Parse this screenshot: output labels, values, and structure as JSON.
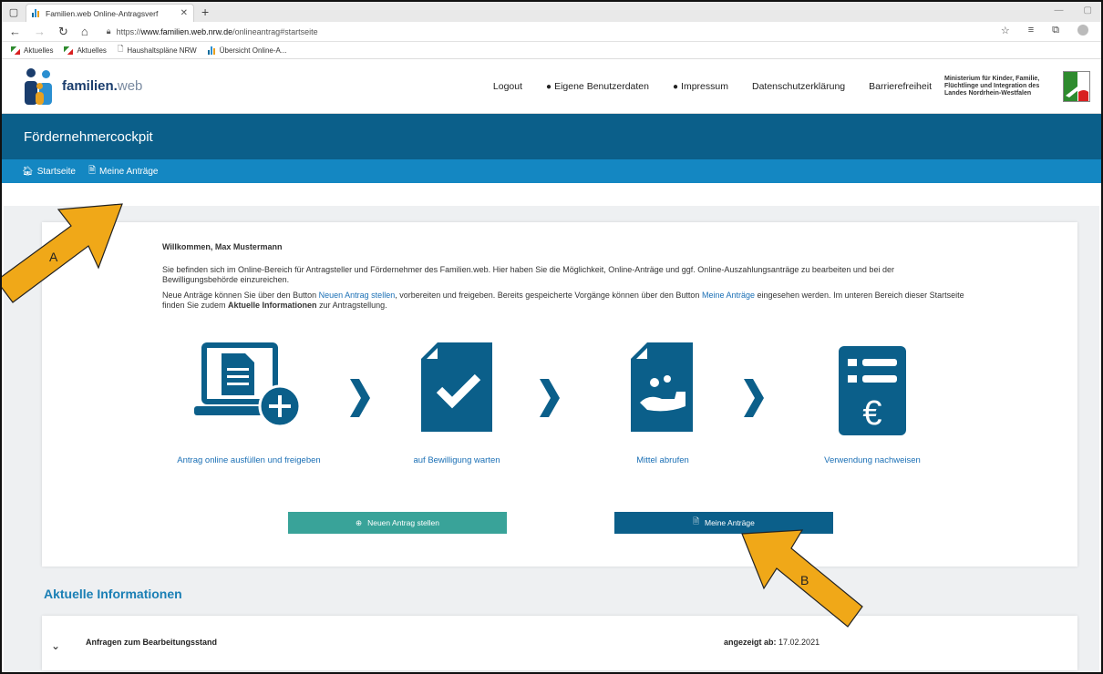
{
  "browser": {
    "tab_title": "Familien.web Online-Antragsverf",
    "url_prefix": "https://",
    "url_host": "www.familien.web.nrw.de",
    "url_path": "/onlineantrag#startseite",
    "bookmarks": [
      "Aktuelles",
      "Aktuelles",
      "Haushaltspläne NRW",
      "Übersicht Online-A..."
    ]
  },
  "header": {
    "logo_bold": "familien.",
    "logo_light": "web",
    "nav": [
      "Logout",
      "Eigene Benutzerdaten",
      "Impressum",
      "Datenschutzerklärung",
      "Barrierefreiheit"
    ],
    "ministry": "Ministerium für Kinder, Familie, Flüchtlinge und Integration des Landes Nordrhein-Westfalen"
  },
  "banner": {
    "title": "Fördernehmercockpit"
  },
  "subnav": {
    "home": "Startseite",
    "my_applications": "Meine Anträge"
  },
  "welcome": {
    "greeting": "Willkommen, Max Mustermann",
    "p1": "Sie befinden sich im Online-Bereich für Antragsteller und Fördernehmer des Familien.web. Hier haben Sie die Möglichkeit, Online-Anträge und ggf. Online-Auszahlungsanträge zu bearbeiten und bei der Bewilligungsbehörde einzureichen.",
    "p2_a": "Neue Anträge können Sie über den Button ",
    "p2_link1": "Neuen Antrag stellen",
    "p2_b": ", vorbereiten und freigeben. Bereits gespeicherte Vorgänge können über den Button ",
    "p2_link2": "Meine Anträge",
    "p2_c": " eingesehen werden. Im unteren Bereich dieser Startseite finden Sie zudem ",
    "p2_bold": "Aktuelle Informationen",
    "p2_d": " zur Antragstellung."
  },
  "steps": [
    {
      "label": "Antrag online ausfüllen und freigeben",
      "icon": "laptop-document-plus-icon"
    },
    {
      "label": "auf Bewilligung warten",
      "icon": "document-check-icon"
    },
    {
      "label": "Mittel abrufen",
      "icon": "hand-coin-icon"
    },
    {
      "label": "Verwendung nachweisen",
      "icon": "list-euro-icon"
    }
  ],
  "buttons": {
    "new_application": "Neuen Antrag stellen",
    "my_applications": "Meine Anträge"
  },
  "info": {
    "title": "Aktuelle Informationen",
    "row_title": "Anfragen zum Bearbeitungsstand",
    "row_date_label": "angezeigt ab:",
    "row_date": "17.02.2021"
  },
  "annotations": {
    "a": "A",
    "b": "B"
  },
  "colors": {
    "primary": "#0b5f8a",
    "subnav": "#1487c2",
    "green": "#39a399",
    "arrow": "#f0a818"
  }
}
